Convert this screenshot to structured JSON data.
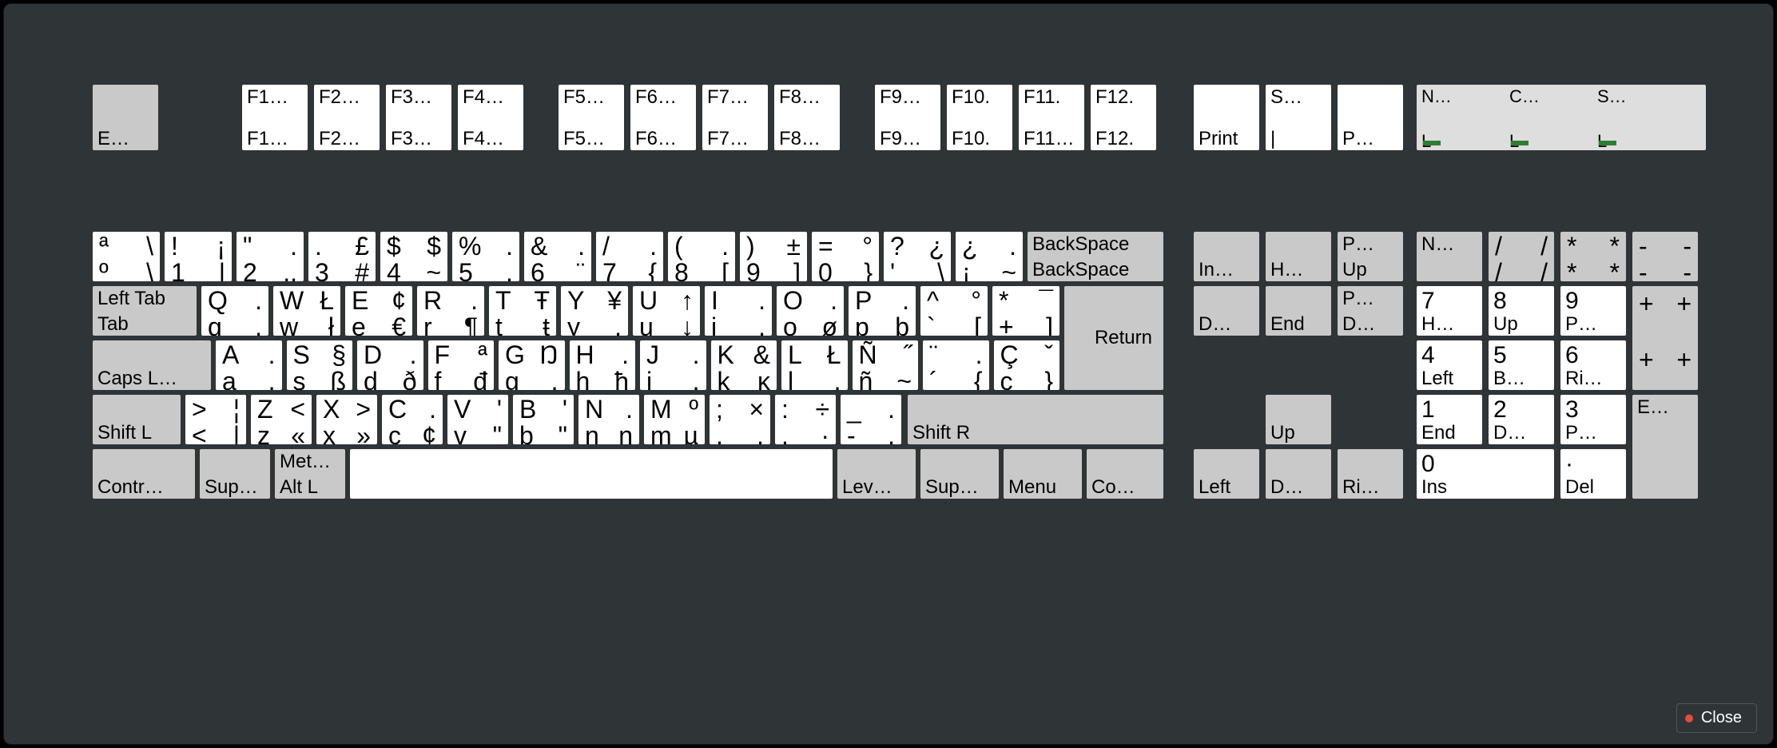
{
  "close": "Close",
  "fn": [
    [
      "F1…",
      "F1…"
    ],
    [
      "F2…",
      "F2…"
    ],
    [
      "F3…",
      "F3…"
    ],
    [
      "F4…",
      "F4…"
    ],
    [
      "F5…",
      "F5…"
    ],
    [
      "F6…",
      "F6…"
    ],
    [
      "F7…",
      "F7…"
    ],
    [
      "F8…",
      "F8…"
    ],
    [
      "F9…",
      "F9…"
    ],
    [
      "F10.",
      "F10."
    ],
    [
      "F11.",
      "F11…"
    ],
    [
      "F12.",
      "F12."
    ]
  ],
  "esc": "E…",
  "print": "Print",
  "scroll": {
    "t": "S…",
    "b": "|"
  },
  "pause": "P…",
  "locks": [
    [
      "N…",
      "L"
    ],
    [
      "C…",
      "L"
    ],
    [
      "S…",
      "L"
    ]
  ],
  "row1": [
    {
      "c": [
        "ª",
        "\\",
        "º",
        "\\"
      ]
    },
    {
      "c": [
        "!",
        "¡",
        "1",
        "|"
      ]
    },
    {
      "c": [
        "\"",
        ".",
        "2",
        ".."
      ]
    },
    {
      "c": [
        ".",
        "£",
        "3",
        "#"
      ]
    },
    {
      "c": [
        "$",
        "$",
        "4",
        "~"
      ]
    },
    {
      "c": [
        "%",
        ".",
        "5",
        "."
      ]
    },
    {
      "c": [
        "&",
        ".",
        "6",
        "¨"
      ]
    },
    {
      "c": [
        "/",
        ".",
        "7",
        "{"
      ]
    },
    {
      "c": [
        "(",
        ".",
        "8",
        "["
      ]
    },
    {
      "c": [
        ")",
        "±",
        "9",
        "]"
      ]
    },
    {
      "c": [
        "=",
        "°",
        "0",
        "}"
      ]
    },
    {
      "c": [
        "?",
        "¿",
        "'",
        "\\"
      ]
    },
    {
      "c": [
        "¿",
        ".",
        "¡",
        "~"
      ]
    }
  ],
  "bs": [
    "BackSpace",
    "BackSpace"
  ],
  "tab": [
    "Left Tab",
    "Tab"
  ],
  "row2": [
    {
      "c": [
        "Q",
        ".",
        "q",
        "."
      ]
    },
    {
      "c": [
        "W",
        "Ł",
        "w",
        "ł"
      ]
    },
    {
      "c": [
        "E",
        "¢",
        "e",
        "€"
      ]
    },
    {
      "c": [
        "R",
        ".",
        "r",
        "¶"
      ]
    },
    {
      "c": [
        "T",
        "Ŧ",
        "t",
        "ŧ"
      ]
    },
    {
      "c": [
        "Y",
        "¥",
        "y",
        "."
      ]
    },
    {
      "c": [
        "U",
        "↑",
        "u",
        "↓"
      ]
    },
    {
      "c": [
        "I",
        ".",
        "i",
        "."
      ]
    },
    {
      "c": [
        "O",
        ".",
        "o",
        "ø"
      ]
    },
    {
      "c": [
        "P",
        ".",
        "p",
        "þ"
      ]
    },
    {
      "c": [
        "^",
        "°",
        "`",
        "["
      ]
    },
    {
      "c": [
        "*",
        "¯",
        "+",
        "]"
      ]
    }
  ],
  "ret": "Return",
  "caps": "Caps L…",
  "row3": [
    {
      "c": [
        "A",
        ".",
        "a",
        "."
      ]
    },
    {
      "c": [
        "S",
        "§",
        "s",
        "ß"
      ]
    },
    {
      "c": [
        "D",
        ".",
        "d",
        "ð"
      ]
    },
    {
      "c": [
        "F",
        "ª",
        "f",
        "đ"
      ]
    },
    {
      "c": [
        "G",
        "Ŋ",
        "g",
        "."
      ]
    },
    {
      "c": [
        "H",
        ".",
        "h",
        "ħ"
      ]
    },
    {
      "c": [
        "J",
        ".",
        "j",
        "."
      ]
    },
    {
      "c": [
        "K",
        "&",
        "k",
        "ĸ"
      ]
    },
    {
      "c": [
        "L",
        "Ł",
        "l",
        "."
      ]
    },
    {
      "c": [
        "Ñ",
        "˝",
        "ñ",
        "~"
      ]
    },
    {
      "c": [
        "¨",
        ".",
        "´",
        "{"
      ]
    },
    {
      "c": [
        "Ç",
        "ˇ",
        "ç",
        "}"
      ]
    }
  ],
  "sl": "Shift L",
  "sr": "Shift R",
  "row4": [
    {
      "c": [
        ">",
        "¦",
        "<",
        "|"
      ]
    },
    {
      "c": [
        "Z",
        "<",
        "z",
        "«"
      ],
      "r": 1
    },
    {
      "c": [
        "X",
        ">",
        "x",
        "»"
      ],
      "r": 1
    },
    {
      "c": [
        "C",
        ".",
        "c",
        "¢"
      ]
    },
    {
      "c": [
        "V",
        "'",
        "v",
        "\""
      ]
    },
    {
      "c": [
        "B",
        "'",
        "b",
        "\""
      ]
    },
    {
      "c": [
        "N",
        ".",
        "n",
        "n"
      ]
    },
    {
      "c": [
        "M",
        "º",
        "m",
        "µ"
      ]
    },
    {
      "c": [
        ";",
        "×",
        ",",
        "."
      ]
    },
    {
      "c": [
        ":",
        "÷",
        ".",
        "·"
      ]
    },
    {
      "c": [
        "_",
        ".",
        "-",
        "."
      ]
    }
  ],
  "ctrl": "Contr…",
  "supl": "Sup…",
  "alt": [
    "Met…",
    "Alt L"
  ],
  "lvl": "Lev…",
  "supr": "Sup…",
  "menu": "Menu",
  "ctrlr": "Co…",
  "nav": {
    "ins": "In…",
    "home": "H…",
    "pgup": [
      "P…",
      "Up"
    ],
    "del": "D…",
    "end": "End",
    "pgdn": [
      "P…",
      "D…"
    ],
    "up": "Up",
    "left": "Left",
    "down": "D…",
    "right": "Ri…"
  },
  "np": {
    "nl": "N…",
    "div": [
      "/",
      "/",
      "/",
      "/"
    ],
    "mul": [
      "*",
      "*",
      "*",
      "*"
    ],
    "sub": [
      "-",
      "-",
      "-",
      "-"
    ],
    "add": [
      "+",
      "+",
      "+",
      "+"
    ],
    "7": [
      "7",
      "H…"
    ],
    "8": [
      "8",
      "Up"
    ],
    "9": [
      "9",
      "P…"
    ],
    "4": [
      "4",
      "Left"
    ],
    "5": [
      "5",
      "B…"
    ],
    "6": [
      "6",
      "Ri…"
    ],
    "1": [
      "1",
      "End"
    ],
    "2": [
      "2",
      "D…"
    ],
    "3": [
      "3",
      "P…"
    ],
    "0": [
      "0",
      "Ins"
    ],
    "dot": [
      "·",
      "Del"
    ],
    "ent": "E…"
  }
}
